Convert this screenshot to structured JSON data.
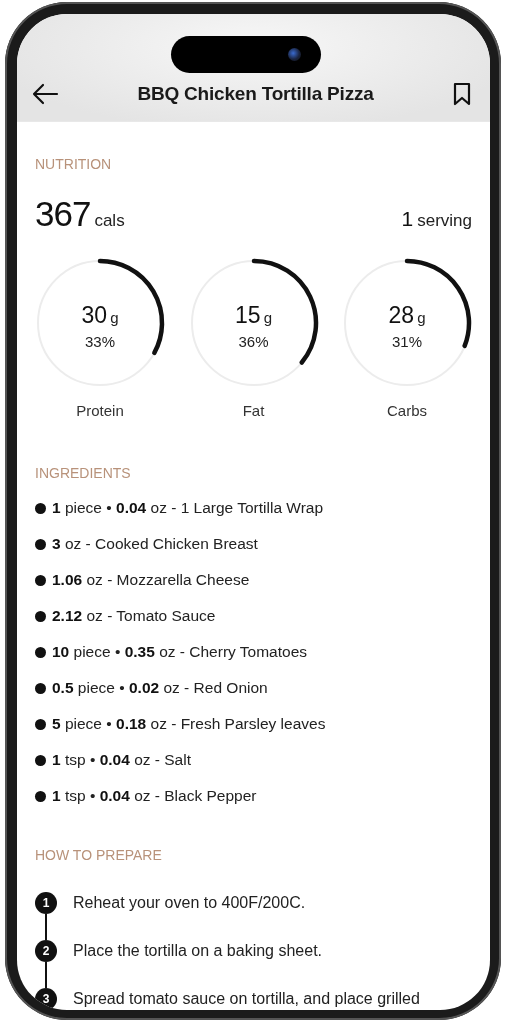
{
  "header": {
    "title": "BBQ Chicken Tortilla Pizza"
  },
  "nutrition": {
    "heading": "NUTRITION",
    "calories": "367",
    "calories_unit": "cals",
    "servings": "1",
    "servings_unit": "serving",
    "macros": [
      {
        "amount": "30",
        "unit": "g",
        "percent": "33%",
        "label": "Protein"
      },
      {
        "amount": "15",
        "unit": "g",
        "percent": "36%",
        "label": "Fat"
      },
      {
        "amount": "28",
        "unit": "g",
        "percent": "31%",
        "label": "Carbs"
      }
    ]
  },
  "ingredients": {
    "heading": "INGREDIENTS",
    "items": [
      "**1** piece • **0.04** oz - 1 Large Tortilla Wrap",
      "**3** oz - Cooked Chicken Breast",
      "**1.06** oz - Mozzarella Cheese",
      "**2.12** oz - Tomato Sauce",
      "**10** piece • **0.35** oz - Cherry Tomatoes",
      "**0.5** piece • **0.02** oz - Red Onion",
      "**5** piece • **0.18** oz - Fresh Parsley leaves",
      "**1** tsp • **0.04** oz - Salt",
      "**1** tsp • **0.04** oz - Black Pepper"
    ]
  },
  "preparation": {
    "heading": "HOW TO PREPARE",
    "steps": [
      {
        "number": "1",
        "text": "Reheat your oven to 400F/200C."
      },
      {
        "number": "2",
        "text": "Place the tortilla on a baking sheet."
      },
      {
        "number": "3",
        "text": "Spread tomato sauce on tortilla, and place grilled"
      }
    ]
  }
}
